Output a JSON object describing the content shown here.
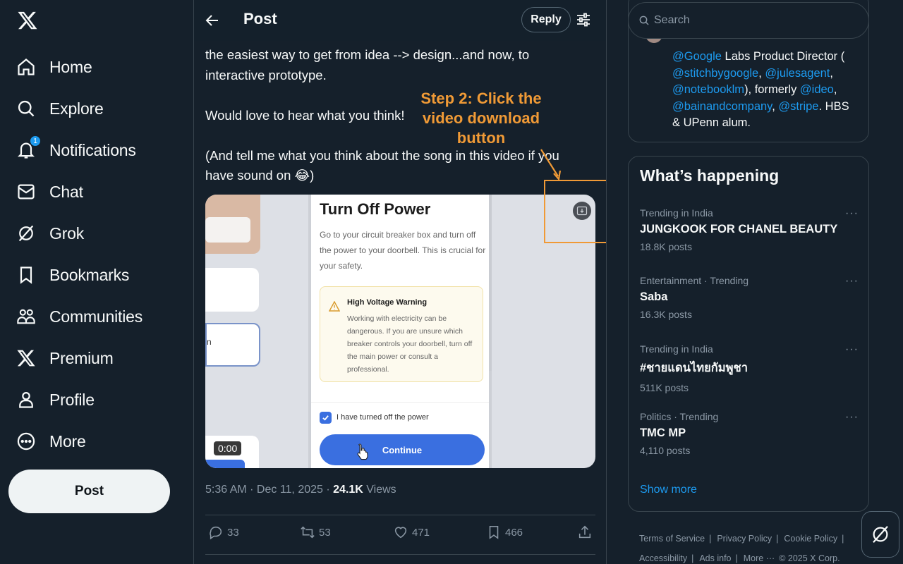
{
  "nav": {
    "items": [
      {
        "label": "Home",
        "icon": "home-icon"
      },
      {
        "label": "Explore",
        "icon": "search-icon"
      },
      {
        "label": "Notifications",
        "icon": "bell-icon",
        "badge": "1"
      },
      {
        "label": "Chat",
        "icon": "mail-icon"
      },
      {
        "label": "Grok",
        "icon": "grok-icon"
      },
      {
        "label": "Bookmarks",
        "icon": "bookmark-icon"
      },
      {
        "label": "Communities",
        "icon": "communities-icon"
      },
      {
        "label": "Premium",
        "icon": "x-logo-icon"
      },
      {
        "label": "Profile",
        "icon": "person-icon"
      },
      {
        "label": "More",
        "icon": "more-circle-icon"
      }
    ],
    "post_button": "Post"
  },
  "header": {
    "title": "Post",
    "reply_button": "Reply"
  },
  "tweet": {
    "paragraphs": [
      "the easiest way to get from idea --> design...and now, to interactive prototype.",
      "Would love to hear what you think!",
      "(And tell me what you think about the song in this video if you have sound on 😂)"
    ],
    "annotation": "Step 2: Click the video download button",
    "video": {
      "screen_title": "Turn Off Power",
      "screen_desc": "Go to your circuit breaker box and turn off the power to your doorbell. This is crucial for your safety.",
      "warning_title": "High Voltage Warning",
      "warning_body": "Working with electricity can be dangerous. If you are unsure which breaker controls your doorbell, turn off the main power or consult a professional.",
      "checkbox_label": "I have turned off the power",
      "button_label": "Continue",
      "side_fragment": "n",
      "timecode": "0:00"
    },
    "timestamp": "5:36 AM · Dec 11, 2025 · ",
    "views_count": "24.1K",
    "views_label": " Views",
    "actions": {
      "replies": "33",
      "reposts": "53",
      "likes": "471",
      "bookmarks": "466"
    }
  },
  "search": {
    "placeholder": "Search"
  },
  "bio": {
    "parts": [
      {
        "t": "@Google",
        "m": true
      },
      {
        "t": " Labs Product Director ( ",
        "m": false
      },
      {
        "t": "@stitchbygoogle",
        "m": true
      },
      {
        "t": ", ",
        "m": false
      },
      {
        "t": "@julesagent",
        "m": true
      },
      {
        "t": ", ",
        "m": false
      },
      {
        "t": "@notebooklm",
        "m": true
      },
      {
        "t": "), formerly ",
        "m": false
      },
      {
        "t": "@ideo",
        "m": true
      },
      {
        "t": ", ",
        "m": false
      },
      {
        "t": "@bainandcompany",
        "m": true
      },
      {
        "t": ", ",
        "m": false
      },
      {
        "t": "@stripe",
        "m": true
      },
      {
        "t": ". HBS & UPenn alum.",
        "m": false
      }
    ]
  },
  "happening": {
    "title": "What’s happening",
    "trends": [
      {
        "meta": "Trending in India",
        "name": "JUNGKOOK FOR CHANEL BEAUTY",
        "count": "18.8K posts"
      },
      {
        "meta": "Entertainment · Trending",
        "name": "Saba",
        "count": "16.3K posts"
      },
      {
        "meta": "Trending in India",
        "name": "#ชายแดนไทยกัมพูชา",
        "count": "511K posts"
      },
      {
        "meta": "Politics · Trending",
        "name": "TMC MP",
        "count": "4,110 posts"
      }
    ],
    "more_icon": "···",
    "show_more": "Show more"
  },
  "footer": {
    "terms": "Terms of Service",
    "privacy": "Privacy Policy",
    "cookie": "Cookie Policy",
    "accessibility": "Accessibility",
    "ads": "Ads info",
    "more": "More ···",
    "copyright": "© 2025 X Corp."
  },
  "colors": {
    "background": "#15202b",
    "accent": "#1d9bf0",
    "annotation": "#f09a36",
    "border": "#38444d",
    "muted": "#8b98a5"
  }
}
